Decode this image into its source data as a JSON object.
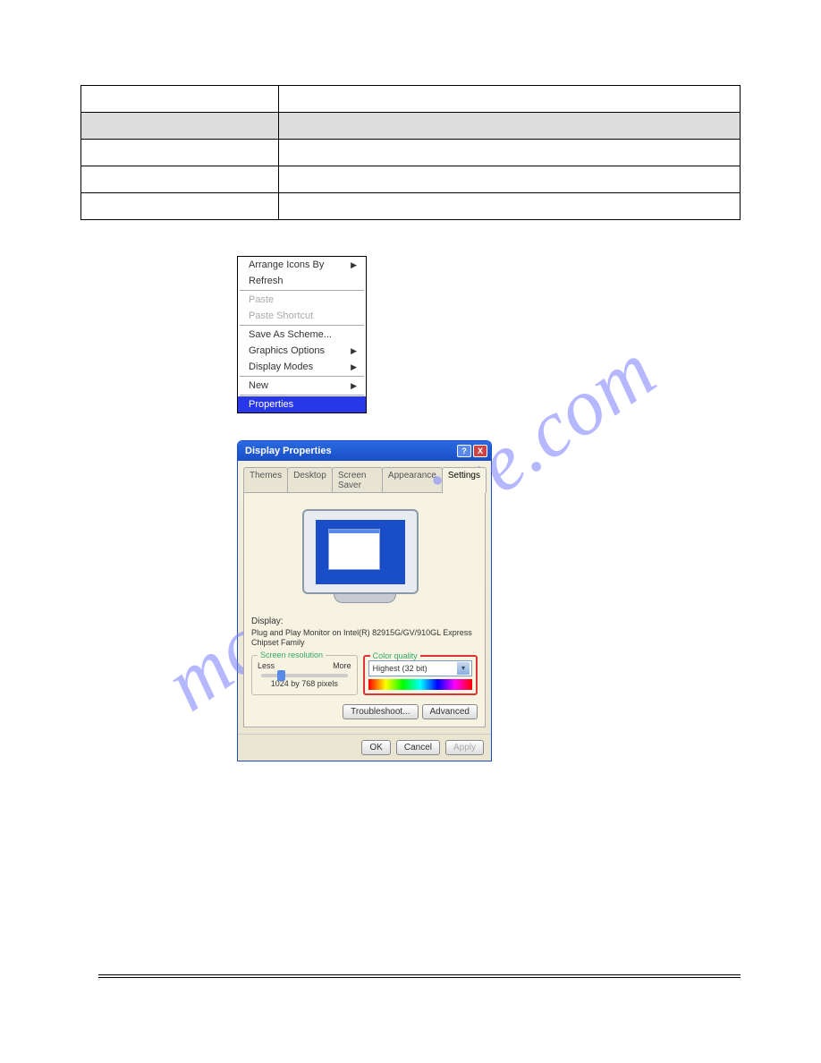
{
  "watermark": "manualshive.com",
  "table": {
    "rows": [
      {
        "c1": "",
        "c2": "",
        "shaded": false
      },
      {
        "c1": "",
        "c2": "",
        "shaded": true
      },
      {
        "c1": "",
        "c2": "",
        "shaded": false
      },
      {
        "c1": "",
        "c2": "",
        "shaded": false
      },
      {
        "c1": "",
        "c2": "",
        "shaded": false
      }
    ]
  },
  "context_menu": {
    "items": [
      {
        "label": "Arrange Icons By",
        "arrow": true,
        "disabled": false
      },
      {
        "label": "Refresh",
        "arrow": false,
        "disabled": false
      },
      {
        "sep": true
      },
      {
        "label": "Paste",
        "arrow": false,
        "disabled": true
      },
      {
        "label": "Paste Shortcut",
        "arrow": false,
        "disabled": true
      },
      {
        "sep": true
      },
      {
        "label": "Save As Scheme...",
        "arrow": false,
        "disabled": false
      },
      {
        "label": "Graphics Options",
        "arrow": true,
        "disabled": false
      },
      {
        "label": "Display Modes",
        "arrow": true,
        "disabled": false
      },
      {
        "sep": true
      },
      {
        "label": "New",
        "arrow": true,
        "disabled": false
      },
      {
        "sep": true
      },
      {
        "label": "Properties",
        "arrow": false,
        "disabled": false,
        "selected": true
      }
    ]
  },
  "dialog": {
    "title": "Display Properties",
    "help_btn": "?",
    "close_btn": "X",
    "tabs": [
      {
        "label": "Themes"
      },
      {
        "label": "Desktop"
      },
      {
        "label": "Screen Saver"
      },
      {
        "label": "Appearance"
      },
      {
        "label": "Settings",
        "active": true
      }
    ],
    "display_heading": "Display:",
    "display_text": "Plug and Play Monitor on Intel(R) 82915G/GV/910GL Express Chipset Family",
    "screen_res": {
      "title": "Screen resolution",
      "less": "Less",
      "more": "More",
      "value": "1024 by 768 pixels"
    },
    "color_quality": {
      "title": "Color quality",
      "value": "Highest (32 bit)"
    },
    "buttons": {
      "troubleshoot": "Troubleshoot...",
      "advanced": "Advanced",
      "ok": "OK",
      "cancel": "Cancel",
      "apply": "Apply"
    }
  }
}
